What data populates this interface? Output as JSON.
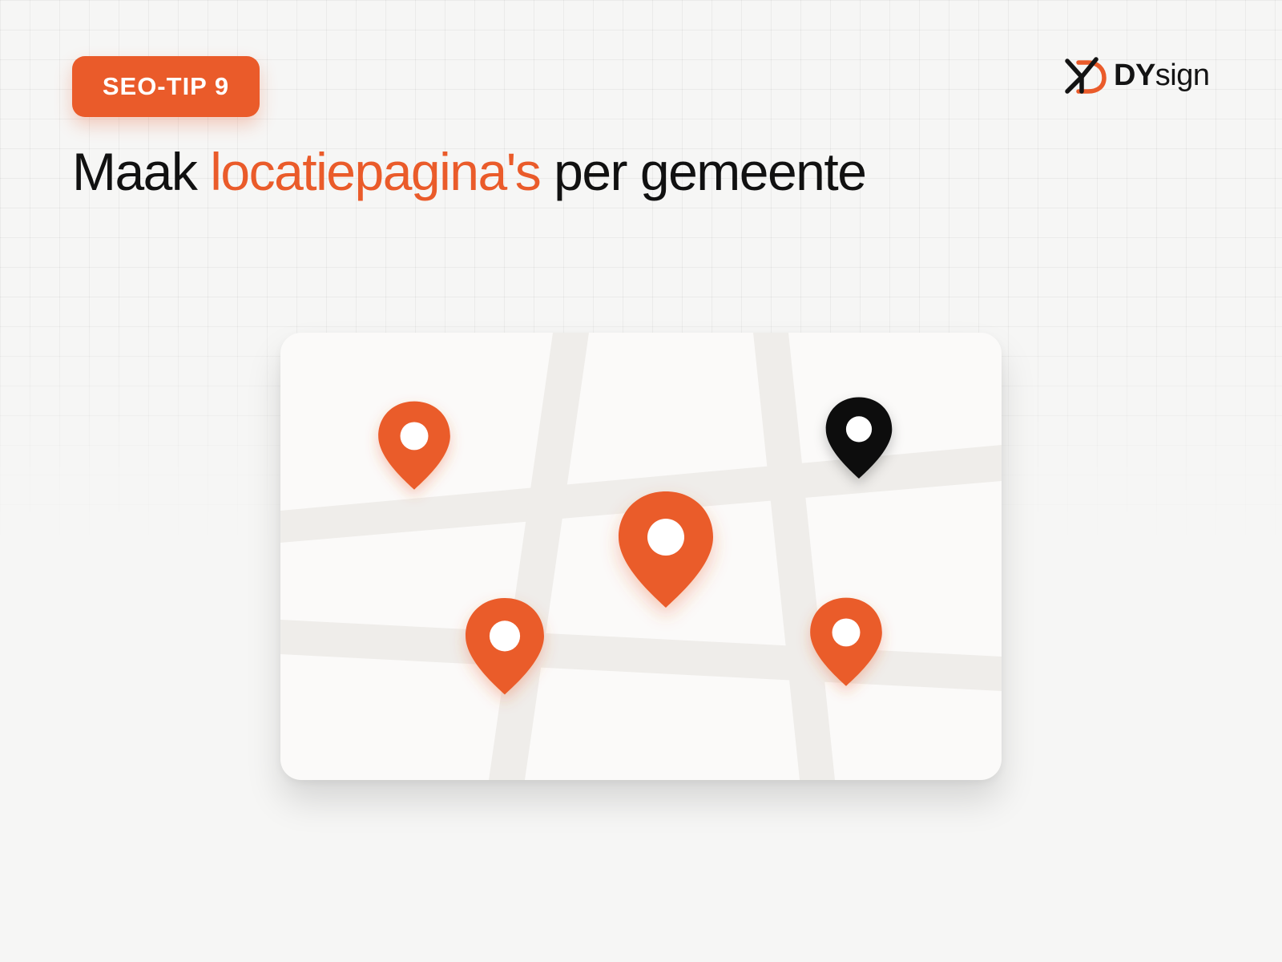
{
  "badge": {
    "label": "SEO-TIP 9"
  },
  "brand": {
    "name_upper": "DY",
    "name_lower": "sign",
    "logo_icon": "dy-monogram-icon",
    "colors": {
      "black": "#141414",
      "orange": "#ea5b2a"
    }
  },
  "headline": {
    "part1": "Maak ",
    "highlight": "locatiepagina's",
    "part2": " per gemeente"
  },
  "map": {
    "icon": "map-with-location-pins",
    "road_color": "#efedea",
    "pin_count_orange": 4,
    "pin_count_black": 1,
    "colors": {
      "accent": "#ea5b2a",
      "dark": "#111111",
      "background": "#fbfaf9",
      "page": "#f6f6f5"
    }
  }
}
